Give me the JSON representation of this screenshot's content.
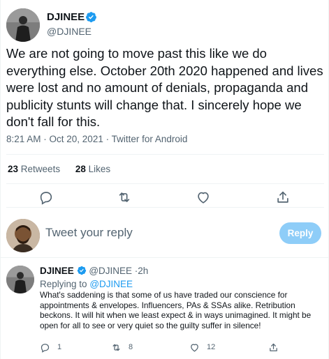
{
  "main_tweet": {
    "author": {
      "name": "DJINEE",
      "handle": "@DJINEE",
      "verified": true
    },
    "text": "We are not going to move past this like we do everything else. October 20th 2020 happened and lives were lost and no amount of denials, propaganda and publicity stunts will change that. I sincerely hope we don't fall for this.",
    "timestamp": "8:21 AM · Oct 20, 2021 · Twitter for Android",
    "stats": {
      "retweets_count": "23",
      "retweets_label": "Retweets",
      "likes_count": "28",
      "likes_label": "Likes"
    },
    "actions": [
      {
        "name": "reply",
        "icon": "reply-icon"
      },
      {
        "name": "retweet",
        "icon": "retweet-icon"
      },
      {
        "name": "like",
        "icon": "heart-icon"
      },
      {
        "name": "share",
        "icon": "share-icon"
      }
    ]
  },
  "composer": {
    "placeholder": "Tweet your reply",
    "reply_button": "Reply"
  },
  "reply_tweet": {
    "author": {
      "name": "DJINEE",
      "handle": "@DJINEE",
      "verified": true
    },
    "separator": "·",
    "time": "2h",
    "replying_to_label": "Replying to",
    "replying_to_handle": "@DJINEE",
    "text": "What's saddening is that some of us have traded our conscience for appointments & envelopes. Influencers, PAs & SSAs alike. Retribution beckons. It will hit when we least expect & in ways unimagined. It might be open for all to see or very quiet so the guilty suffer in silence!",
    "reply_count": "1",
    "retweet_count": "8",
    "like_count": "12"
  },
  "colors": {
    "text_primary": "#0f1419",
    "text_secondary": "#536471",
    "accent": "#1d9bf0",
    "reply_button_disabled": "#8ecdf8",
    "divider": "#eff3f4"
  }
}
